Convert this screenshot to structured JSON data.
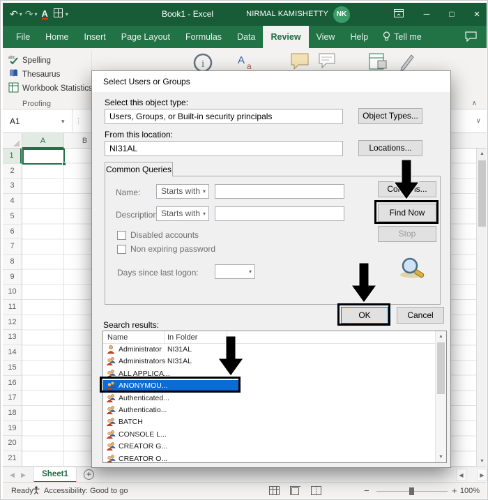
{
  "colors": {
    "excel_green": "#217346",
    "title_bar_green": "#185c37",
    "selection_blue": "#0a6cd6",
    "annotation_black": "#000000"
  },
  "icons": {
    "undo": "↶",
    "redo": "↷",
    "dropdown": "▾",
    "minimize": "─",
    "maximize": "□",
    "close": "×",
    "up": "▲",
    "down": "▼",
    "left": "◀",
    "right": "▶",
    "collapse_ribbon": "∧",
    "expand_formula": "∨",
    "plus": "+",
    "zoom_out": "−",
    "zoom_in": "+",
    "splitter_dots": "⋮"
  },
  "titlebar": {
    "title": "Book1 - Excel",
    "user_name": "NIRMAL KAMISHETTY",
    "user_initials": "NK"
  },
  "ribbon": {
    "tabs": [
      "File",
      "Home",
      "Insert",
      "Page Layout",
      "Formulas",
      "Data",
      "Review",
      "View",
      "Help"
    ],
    "selected_tab": "Review",
    "tell_me_label": "Tell me",
    "proofing": {
      "items": [
        "Spelling",
        "Thesaurus",
        "Workbook Statistics"
      ],
      "group_label": "Proofing"
    }
  },
  "formula_bar": {
    "name_box_value": "A1"
  },
  "grid": {
    "visible_columns": [
      "A",
      "B"
    ],
    "row_numbers": [
      "1",
      "2",
      "3",
      "4",
      "5",
      "6",
      "7",
      "8",
      "9",
      "10",
      "11",
      "12",
      "13",
      "14",
      "15",
      "16",
      "17",
      "18",
      "19",
      "20",
      "21"
    ],
    "selected_cell": "A1"
  },
  "sheet_tabs": {
    "active_sheet": "Sheet1"
  },
  "status_bar": {
    "mode": "Ready",
    "accessibility": "Accessibility: Good to go",
    "zoom_level": "100%"
  },
  "dialog": {
    "title": "Select Users or Groups",
    "object_type": {
      "label": "Select this object type:",
      "value": "Users, Groups, or Built-in security principals",
      "button": "Object Types..."
    },
    "location": {
      "label": "From this location:",
      "value": "NI31AL",
      "button": "Locations..."
    },
    "common_queries": {
      "tab_label": "Common Queries",
      "name_label": "Name:",
      "name_operator": "Starts with",
      "name_value": "",
      "description_label": "Description:",
      "description_operator": "Starts with",
      "description_value": "",
      "disabled_accounts_label": "Disabled accounts",
      "disabled_accounts_checked": false,
      "non_expiring_label": "Non expiring password",
      "non_expiring_checked": false,
      "days_label": "Days since last logon:",
      "days_value": "",
      "columns_button": "Columns...",
      "find_now_button": "Find Now",
      "stop_button": "Stop"
    },
    "ok_button": "OK",
    "cancel_button": "Cancel",
    "search_results_label": "Search results:",
    "results": {
      "columns": [
        "Name",
        "In Folder"
      ],
      "rows": [
        {
          "name": "Administrator",
          "folder": "NI31AL",
          "icon": "user",
          "selected": false
        },
        {
          "name": "Administrators",
          "folder": "NI31AL",
          "icon": "group",
          "selected": false
        },
        {
          "name": "ALL APPLICA...",
          "folder": "",
          "icon": "group",
          "selected": false
        },
        {
          "name": "ANONYMOU...",
          "folder": "",
          "icon": "group",
          "selected": true
        },
        {
          "name": "Authenticated...",
          "folder": "",
          "icon": "group",
          "selected": false
        },
        {
          "name": "Authenticatio...",
          "folder": "",
          "icon": "group",
          "selected": false
        },
        {
          "name": "BATCH",
          "folder": "",
          "icon": "group",
          "selected": false
        },
        {
          "name": "CONSOLE L...",
          "folder": "",
          "icon": "group",
          "selected": false
        },
        {
          "name": "CREATOR G...",
          "folder": "",
          "icon": "group",
          "selected": false
        },
        {
          "name": "CREATOR O...",
          "folder": "",
          "icon": "group",
          "selected": false
        }
      ]
    }
  }
}
